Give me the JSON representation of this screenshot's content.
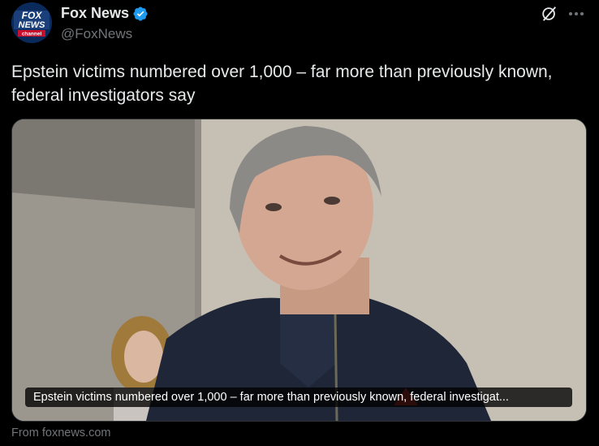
{
  "author": {
    "name": "Fox News",
    "handle": "@FoxNews",
    "avatar_logo_lines": [
      "FOX",
      "NEWS",
      "channel"
    ]
  },
  "post": {
    "text": "Epstein victims numbered over 1,000 – far more than previously known, federal investigators say"
  },
  "card": {
    "caption": "Epstein victims numbered over 1,000 – far more than previously known, federal investigat...",
    "source": "From foxnews.com"
  },
  "icons": {
    "verified": "verified-badge-icon",
    "grok": "grok-icon",
    "more": "more-icon"
  },
  "colors": {
    "background": "#000000",
    "verified": "#1d9bf0",
    "secondary_text": "#71767b",
    "logo_blue": "#003366"
  }
}
